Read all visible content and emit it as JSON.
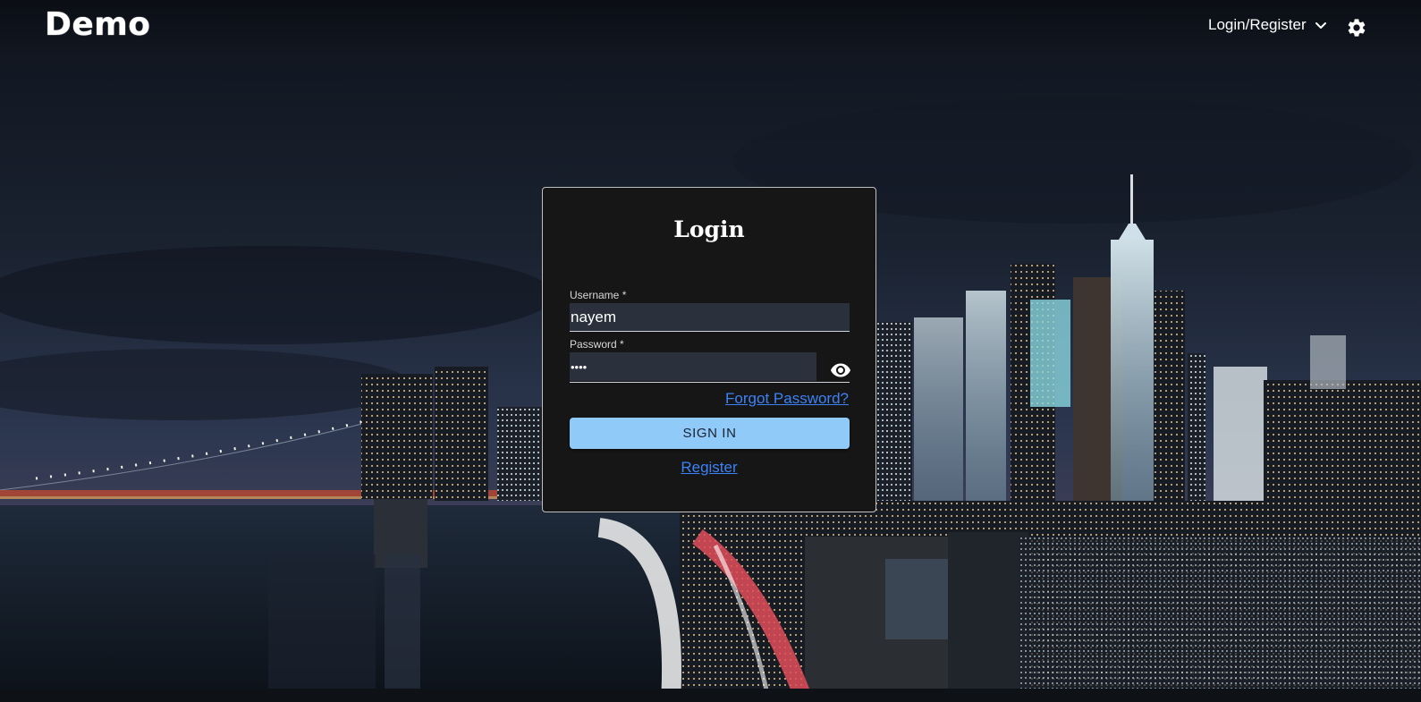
{
  "header": {
    "brand": "Demo",
    "menu_label": "Login/Register"
  },
  "login": {
    "title": "Login",
    "username_label": "Username *",
    "username_value": "nayem",
    "password_label": "Password *",
    "password_value": "••••",
    "forgot_link": "Forgot Password?",
    "signin_label": "SIGN IN",
    "register_link": "Register"
  },
  "colors": {
    "accent_button": "#90caf9",
    "link": "#3b82f6",
    "card_bg": "#161616",
    "input_bg": "#2a313c"
  },
  "icons": {
    "menu_chevron": "chevron-down-icon",
    "settings": "gear-icon",
    "password_toggle": "eye-icon"
  }
}
